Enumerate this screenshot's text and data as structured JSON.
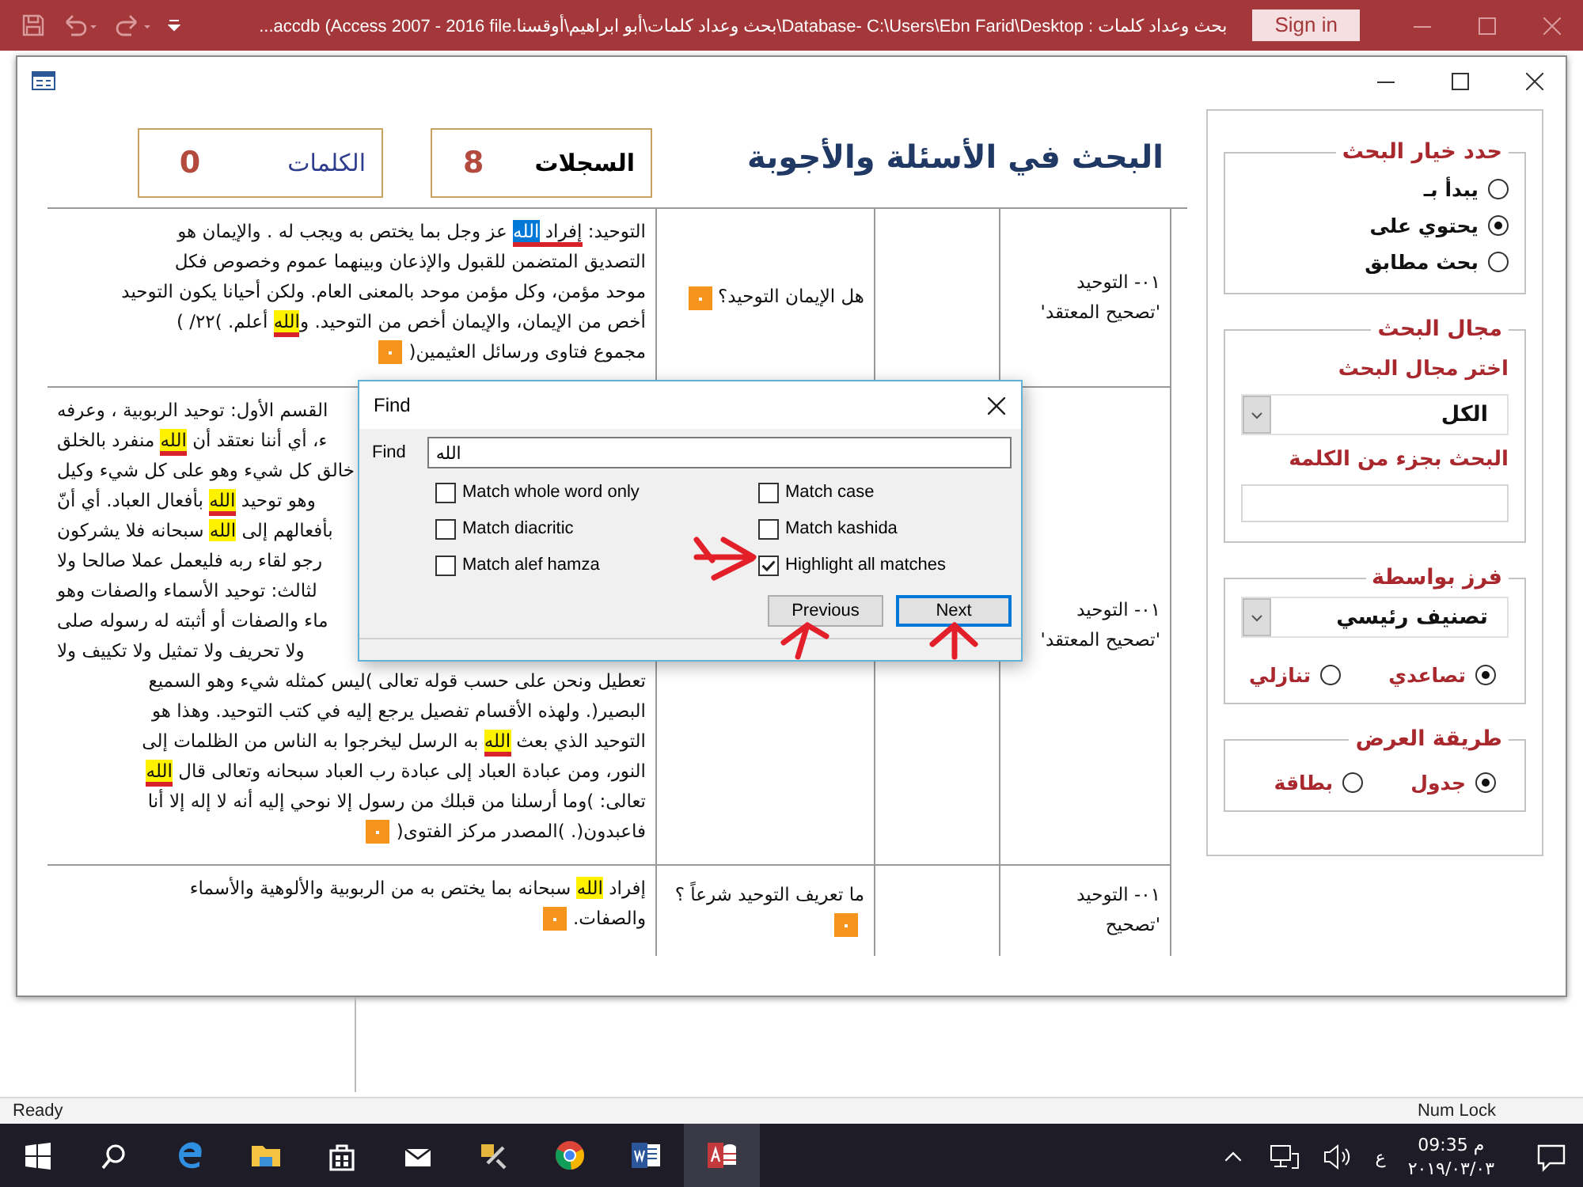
{
  "app_title_bar": {
    "title": "بحث وعداد كلمات : Database- C:\\Users\\Ebn Farid\\Desktop\\بحث وعداد كلمات\\أبو ابراهيم\\أوقسنا.accdb (Access 2007 - 2016 file...",
    "sign_in": "Sign in"
  },
  "header": {
    "title": "البحث في الأسئلة والأجوبة",
    "records_label": "السجلات",
    "records_count": "8",
    "words_label": "الكلمات",
    "words_count": "0"
  },
  "table": {
    "rows": [
      {
        "category": "٠١- التوحيد 'تصحيح المعتقد'",
        "question": "هل الإيمان التوحيد؟",
        "question_marker": true,
        "answer_marker": true,
        "answer": [
          [
            {
              "text": "التوحيد: "
            },
            {
              "text": "إفراد ",
              "underlined": true
            },
            {
              "text": "الله",
              "highlighted": true,
              "current": true,
              "underlined": true
            },
            {
              "text": " عز وجل بما يختص به ويجب له . والإيمان هو"
            }
          ],
          [
            {
              "text": "التصديق المتضمن للقبول والإذعان وبينهما عموم وخصوص فكل"
            }
          ],
          [
            {
              "text": "موحد مؤمن، وكل مؤمن موحد بالمعنى العام. ولكن أحيانا يكون التوحيد"
            }
          ],
          [
            {
              "text": "أخص من الإيمان، والإيمان أخص من التوحيد. و"
            },
            {
              "text": "الله",
              "highlighted": true,
              "underlined": true
            },
            {
              "text": " أعلم. )٢٢/ )"
            }
          ],
          [
            {
              "text": "مجموع فتاوى ورسائل العثيمين("
            }
          ]
        ]
      },
      {
        "category": "٠١- التوحيد 'تصحيح المعتقد'",
        "answer_marker": true,
        "answer": [
          [
            {
              "text": "القسم الأول: توحيد الربوبية ، وعرفه"
            }
          ],
          [
            {
              "text": "ء، أي أننا نعتقد أن "
            },
            {
              "text": "الله",
              "highlighted": true,
              "underlined": true
            },
            {
              "text": " منفرد بالخلق"
            }
          ],
          [
            {
              "text": "خالق كل شيء وهو على كل شيء وكيل"
            }
          ],
          [
            {
              "text": "وهو توحيد "
            },
            {
              "text": "الله",
              "highlighted": true,
              "underlined": true
            },
            {
              "text": " بأفعال العباد. أي أنّ"
            }
          ],
          [
            {
              "text": "بأفعالهم إلى "
            },
            {
              "text": "الله",
              "highlighted": true
            },
            {
              "text": " سبحانه فلا يشركون"
            }
          ],
          [
            {
              "text": "رجو لقاء ربه فليعمل عملا صالحا ولا"
            }
          ],
          [
            {
              "text": "لثالث: توحيد الأسماء والصفات وهو"
            }
          ],
          [
            {
              "text": "ماء والصفات أو أثبته له رسوله صلى"
            }
          ],
          [
            {
              "text": "ولا تحريف ولا تمثيل ولا تكييف ولا"
            }
          ],
          [
            {
              "text": "تعطيل ونحن على حسب قوله تعالى )ليس كمثله شيء وهو السميع"
            }
          ],
          [
            {
              "text": "البصير(. ولهذه الأقسام تفصيل يرجع إليه في كتب التوحيد. وهذا هو"
            }
          ],
          [
            {
              "text": "التوحيد الذي بعث "
            },
            {
              "text": "الله",
              "highlighted": true,
              "underlined": true
            },
            {
              "text": " به الرسل ليخرجوا به الناس من الظلمات إلى"
            }
          ],
          [
            {
              "text": "النور، ومن عبادة العباد إلى عبادة رب العباد سبحانه وتعالى قال "
            },
            {
              "text": "الله",
              "highlighted": true,
              "underlined": true
            }
          ],
          [
            {
              "text": "تعالى: )وما أرسلنا من قبلك من رسول إلا نوحي إليه أنه لا إله إلا أنا"
            }
          ],
          [
            {
              "text": "فاعبدون(. )المصدر مركز الفتوى("
            }
          ]
        ]
      },
      {
        "category": "٠١- التوحيد 'تصحيح",
        "question": "ما تعريف التوحيد شرعاً ؟",
        "question_marker": true,
        "answer_marker": true,
        "answer": [
          [
            {
              "text": "إفراد "
            },
            {
              "text": "الله",
              "highlighted": true
            },
            {
              "text": " سبحانه بما يختص به من الربوبية والألوهية والأسماء"
            }
          ],
          [
            {
              "text": "والصفات."
            }
          ]
        ]
      }
    ]
  },
  "options": {
    "groups": [
      {
        "title": "حدد خيار البحث",
        "controls": [
          {
            "kind": "radio_column",
            "options": [
              {
                "label": "يبدأ بـ",
                "selected": false
              },
              {
                "label": "يحتوي على",
                "selected": true
              },
              {
                "label": "بحث مطابق",
                "selected": false
              }
            ]
          }
        ]
      },
      {
        "title": "مجال البحث",
        "controls": [
          {
            "kind": "label",
            "text": "اختر مجال البحث"
          },
          {
            "kind": "combo",
            "value": "الكل"
          },
          {
            "kind": "label",
            "text": "البحث بجزء من الكلمة"
          },
          {
            "kind": "input"
          }
        ]
      },
      {
        "title": "فرز بواسطة",
        "controls": [
          {
            "kind": "combo",
            "value": "تصنيف رئيسي"
          },
          {
            "kind": "radio_row",
            "options": [
              {
                "label": "تصاعدي",
                "selected": true
              },
              {
                "label": "تنازلي",
                "selected": false
              }
            ]
          }
        ]
      },
      {
        "title": "طريقة العرض",
        "controls": [
          {
            "kind": "radio_row",
            "options": [
              {
                "label": "جدول",
                "selected": true
              },
              {
                "label": "بطاقة",
                "selected": false
              }
            ]
          }
        ]
      }
    ]
  },
  "find_dialog": {
    "title": "Find",
    "find_label": "Find",
    "find_value": "الله",
    "options_column_1": [
      {
        "label": "Match whole word only",
        "checked": false
      },
      {
        "label": "Match diacritic",
        "checked": false
      },
      {
        "label": "Match alef hamza",
        "checked": false
      }
    ],
    "options_column_2": [
      {
        "label": "Match case",
        "checked": false
      },
      {
        "label": "Match kashida",
        "checked": false
      },
      {
        "label": "Highlight all matches",
        "checked": true
      }
    ],
    "previous_button": {
      "label": "Previous",
      "default": false
    },
    "next_button": {
      "label": "Next",
      "default": true
    }
  },
  "status_bar": {
    "left": "Ready",
    "right": "Num Lock"
  },
  "taskbar": {
    "language": "ع",
    "time": "09:35 م",
    "date": "٢٠١٩/٠٣/٠٣"
  }
}
